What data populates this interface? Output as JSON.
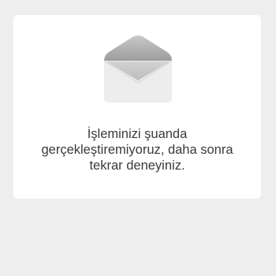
{
  "card": {
    "icon": "envelope-icon",
    "message_lines": [
      "İşleminizi şuanda",
      "gerçekleştiremiyoruz, daha sonra",
      "tekrar deneyiniz."
    ]
  }
}
